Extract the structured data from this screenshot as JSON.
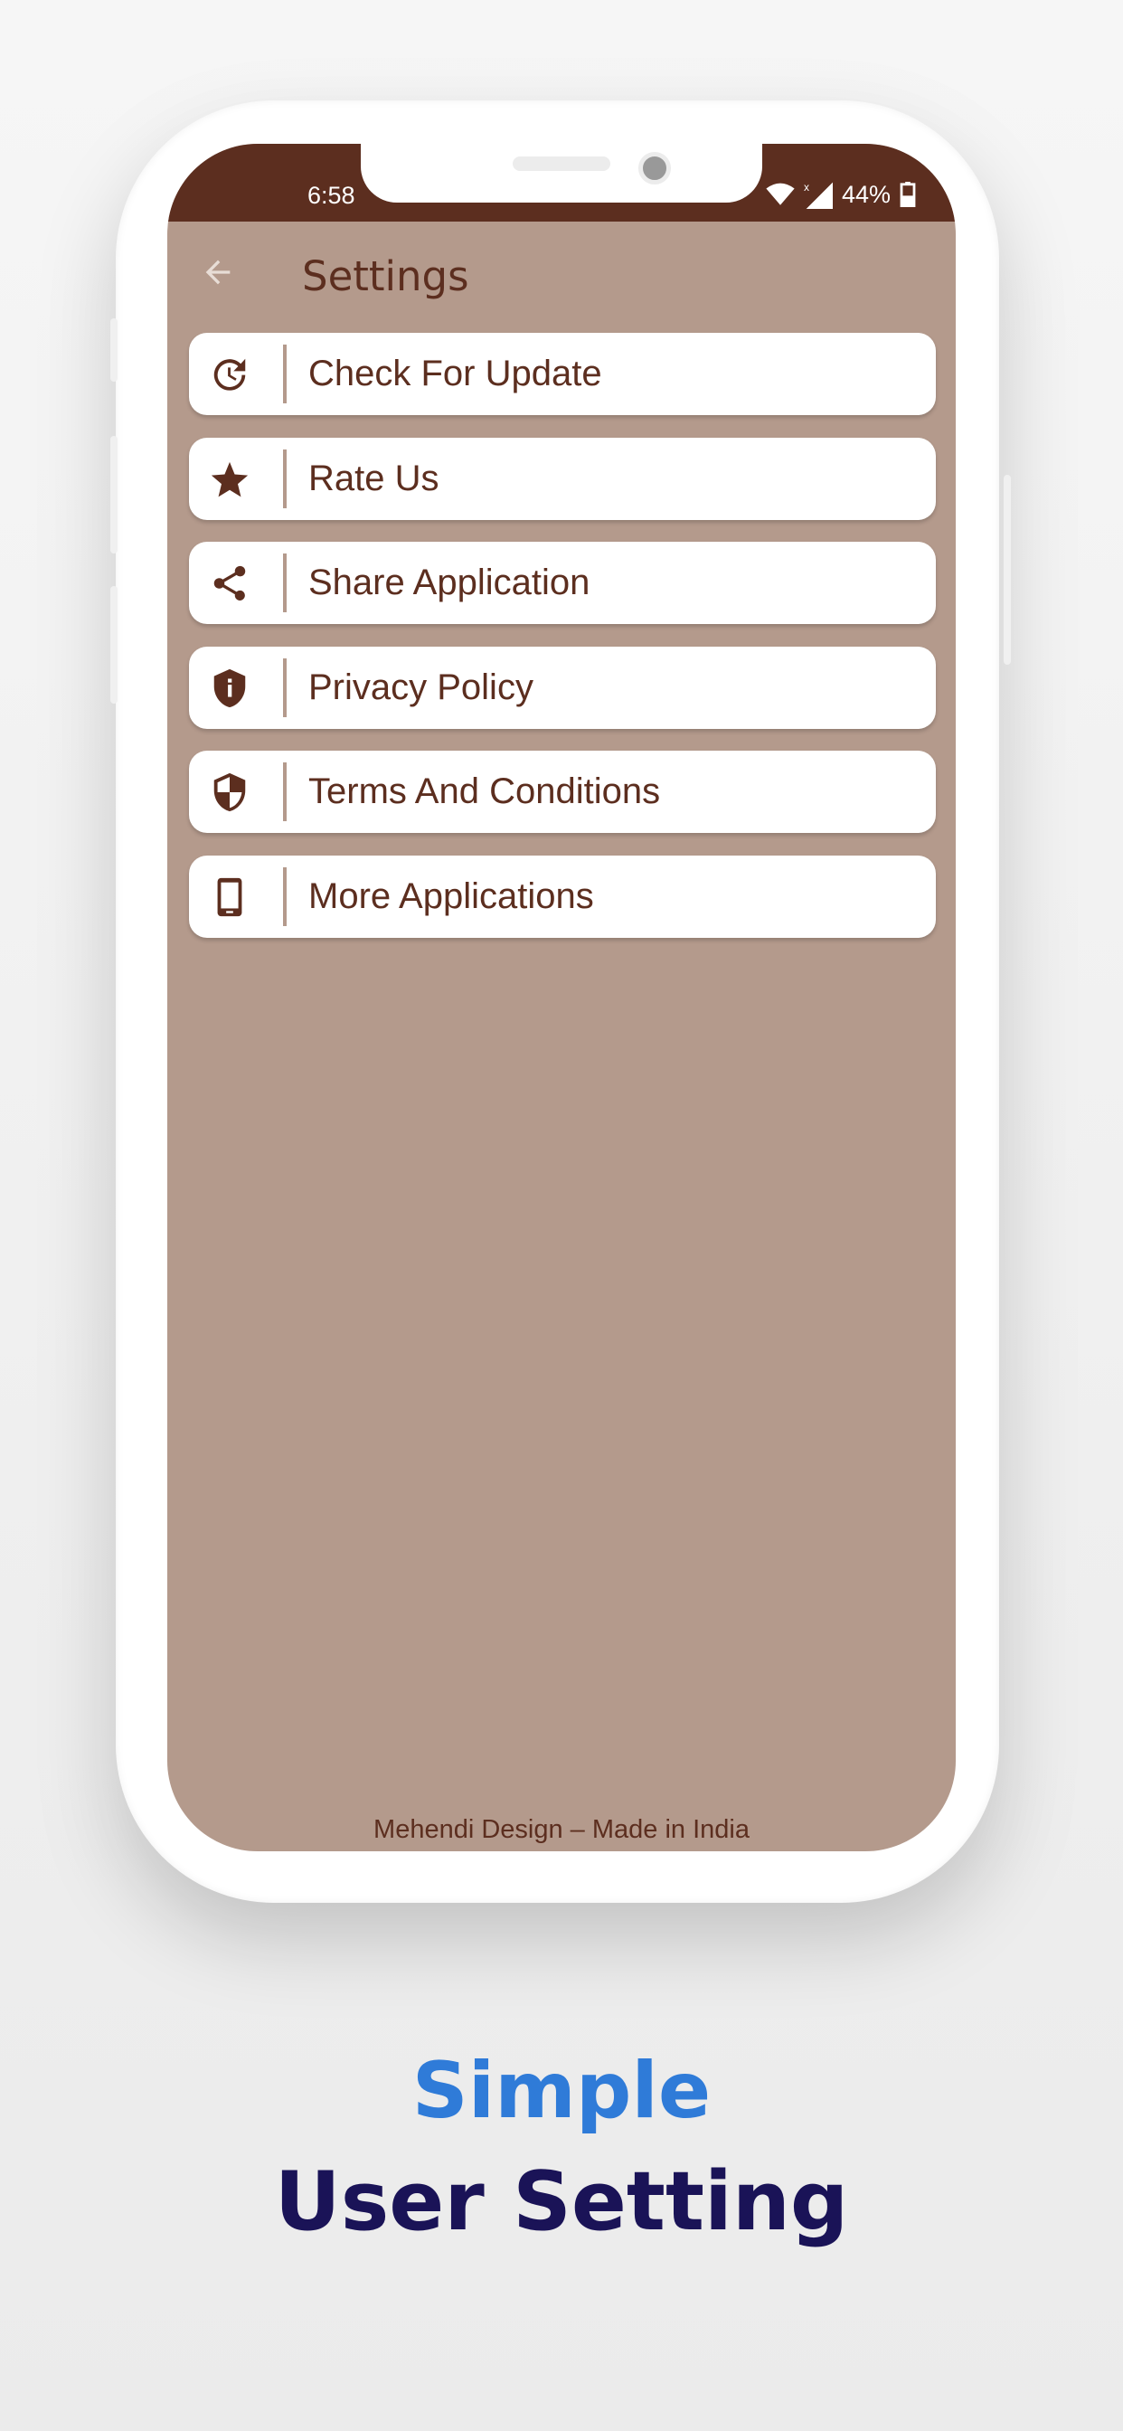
{
  "status_bar": {
    "time": "6:58",
    "battery": "44%"
  },
  "header": {
    "title": "Settings",
    "back_icon": "arrow-back-icon"
  },
  "settings": [
    {
      "label": "Check For Update",
      "icon": "update-icon"
    },
    {
      "label": "Rate Us",
      "icon": "star-icon"
    },
    {
      "label": "Share Application",
      "icon": "share-icon"
    },
    {
      "label": "Privacy Policy",
      "icon": "shield-info-icon"
    },
    {
      "label": "Terms And Conditions",
      "icon": "shield-check-icon"
    },
    {
      "label": "More Applications",
      "icon": "smartphone-icon"
    }
  ],
  "footer": {
    "line1": "Mehendi Design  –  Made in India"
  },
  "promo": {
    "line1": "Simple",
    "line2": "User Setting"
  },
  "colors": {
    "primary": "#5c2e1f",
    "background": "#b49a8c",
    "accent_blue": "#2f7bd8",
    "navy": "#1a1357"
  }
}
